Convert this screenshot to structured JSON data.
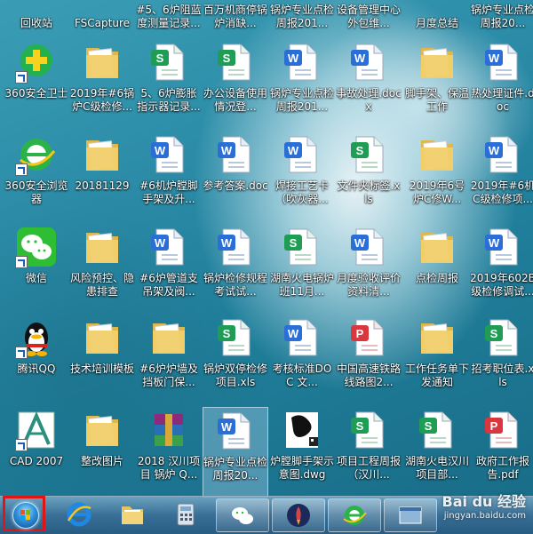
{
  "top_row": [
    {
      "label": "回收站"
    },
    {
      "label": "FSCapture"
    },
    {
      "label": "#5、6炉阻蓝度测量记录..."
    },
    {
      "label": "百万机商停锅炉消缺..."
    },
    {
      "label": "锅炉专业点检周报201..."
    },
    {
      "label": "设备管理中心外包维..."
    },
    {
      "label": "月度总结"
    },
    {
      "label": "锅炉专业点检周报20..."
    }
  ],
  "icons": [
    {
      "label": "360安全卫士",
      "type": "360safe",
      "shortcut": true
    },
    {
      "label": "2019年#6锅炉C级检修...",
      "type": "folder"
    },
    {
      "label": "5、6炉膨胀指示器记录...",
      "type": "sheet"
    },
    {
      "label": "办公设备使用情况登...",
      "type": "sheet"
    },
    {
      "label": "锅炉专业点检周报201...",
      "type": "word"
    },
    {
      "label": "事故处理.docx",
      "type": "word"
    },
    {
      "label": "脚手架、保温工作",
      "type": "folder"
    },
    {
      "label": "热处理证件.doc",
      "type": "word"
    },
    {
      "label": "360安全浏览器",
      "type": "360browser",
      "shortcut": true
    },
    {
      "label": "20181129",
      "type": "folder"
    },
    {
      "label": "#6机炉膛脚手架及升...",
      "type": "word"
    },
    {
      "label": "参考答案.doc",
      "type": "word"
    },
    {
      "label": "焊接工艺卡（吹灰器...",
      "type": "word"
    },
    {
      "label": "文件夹标签.xls",
      "type": "sheet"
    },
    {
      "label": "2019年6号炉C修W...",
      "type": "folder"
    },
    {
      "label": "2019年#6机C级检修项...",
      "type": "word"
    },
    {
      "label": "微信",
      "type": "wechat",
      "shortcut": true
    },
    {
      "label": "风险预控、隐患排查",
      "type": "folder"
    },
    {
      "label": "#6炉管道支吊架及阀...",
      "type": "word"
    },
    {
      "label": "锅炉检修规程考试试...",
      "type": "word"
    },
    {
      "label": "湖南火电锅炉班11月...",
      "type": "sheet"
    },
    {
      "label": "月度验收评价资料清...",
      "type": "word"
    },
    {
      "label": "点检周报",
      "type": "folder"
    },
    {
      "label": "2019年602B级检修调试...",
      "type": "word"
    },
    {
      "label": "腾讯QQ",
      "type": "qq",
      "shortcut": true
    },
    {
      "label": "技术培训模板",
      "type": "folder"
    },
    {
      "label": "#6炉炉墙及挡板门保...",
      "type": "folder"
    },
    {
      "label": "锅炉双停检修项目.xls",
      "type": "sheet"
    },
    {
      "label": "考核标准DOC 文...",
      "type": "word"
    },
    {
      "label": "中国高速铁路线路图2...",
      "type": "pdf"
    },
    {
      "label": "工作任务单下发通知",
      "type": "folder"
    },
    {
      "label": "招考职位表.xls",
      "type": "sheet"
    },
    {
      "label": "CAD 2007",
      "type": "cad",
      "shortcut": true
    },
    {
      "label": "整改图片",
      "type": "folder"
    },
    {
      "label": "2018 汉川项目 锅炉 Q...",
      "type": "winrar"
    },
    {
      "label": "锅炉专业点检周报20...",
      "type": "word",
      "selected": true
    },
    {
      "label": "炉膛脚手架示意图.dwg",
      "type": "dwg"
    },
    {
      "label": "项目工程周报（汉川...",
      "type": "sheet"
    },
    {
      "label": "湖南火电汉川项目部...",
      "type": "sheet"
    },
    {
      "label": "政府工作报告.pdf",
      "type": "pdf"
    }
  ],
  "taskbar": {
    "items": [
      {
        "name": "start-button",
        "icon": "windows-orb-icon"
      },
      {
        "name": "taskbar-internet-explorer",
        "icon": "ie-icon"
      },
      {
        "name": "taskbar-file-explorer",
        "icon": "folder-icon"
      },
      {
        "name": "taskbar-calculator",
        "icon": "calculator-icon"
      },
      {
        "name": "taskbar-wechat",
        "icon": "wechat-icon"
      },
      {
        "name": "taskbar-rocket-app",
        "icon": "rocket-icon"
      },
      {
        "name": "taskbar-360-browser",
        "icon": "360browser-icon"
      },
      {
        "name": "taskbar-window-preview",
        "icon": "window-icon"
      }
    ]
  },
  "watermark": {
    "main": "Bai du 经验",
    "sub": "jingyan.baidu.com"
  },
  "colors": {
    "start_highlight": "#e01616",
    "word": "#2b6fd6",
    "sheet": "#1f9d55",
    "pdf": "#d9363e",
    "folder": "#f1cf6a"
  }
}
